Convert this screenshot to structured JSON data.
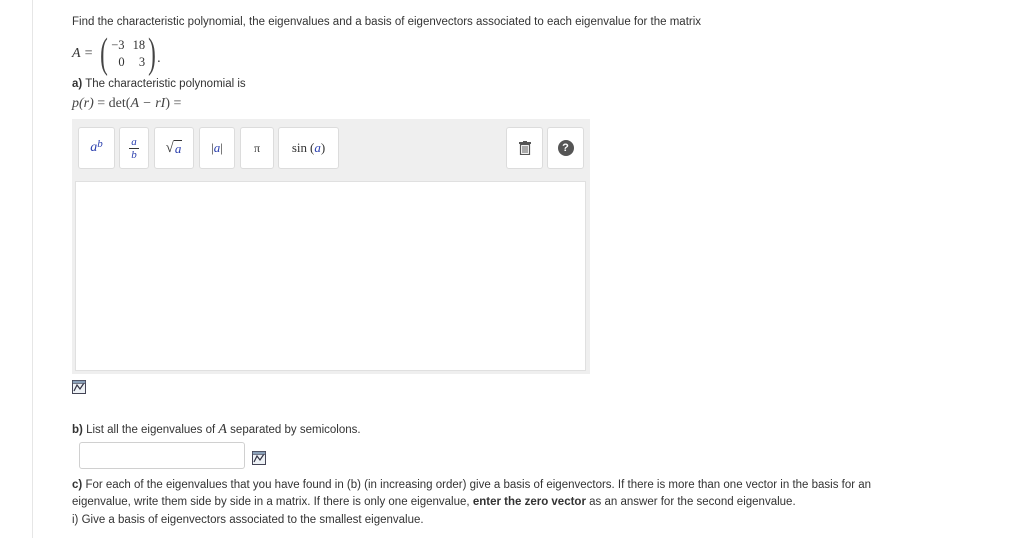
{
  "question": {
    "intro": "Find the characteristic polynomial, the eigenvalues and a basis of eigenvectors associated to each eigenvalue for the matrix",
    "matrix_label": "A =",
    "matrix": [
      [
        "−3",
        "18"
      ],
      [
        "0",
        "3"
      ]
    ],
    "matrix_end": "."
  },
  "part_a": {
    "label": "a)",
    "text": "The characteristic polynomial is",
    "lhs": "p(r)",
    "eq": "= det(",
    "arg": "A − rI",
    "rhs": ") ="
  },
  "editor": {
    "buttons": {
      "power_base": "a",
      "power_exp": "b",
      "frac_num": "a",
      "frac_den": "b",
      "sqrt_arg": "a",
      "abs_arg": "a",
      "pi": "π",
      "sin_fn": "sin",
      "sin_arg": "a"
    },
    "help": "?"
  },
  "part_b": {
    "label": "b)",
    "text_before": "List all the eigenvalues of",
    "var": "A",
    "text_after": "separated by semicolons.",
    "input_value": ""
  },
  "part_c": {
    "label": "c)",
    "text1": "For each of the eigenvalues that you have found in (b) (in increasing order) give a basis of eigenvectors. If there is more than one vector in the basis for an eigenvalue, write them side by side in a matrix. If there is only one eigenvalue,",
    "bold": "enter the zero vector",
    "text2": "as an answer for the second eigenvalue."
  },
  "part_ci": {
    "label": "i)",
    "text": "Give a basis of eigenvectors associated to the smallest eigenvalue."
  }
}
